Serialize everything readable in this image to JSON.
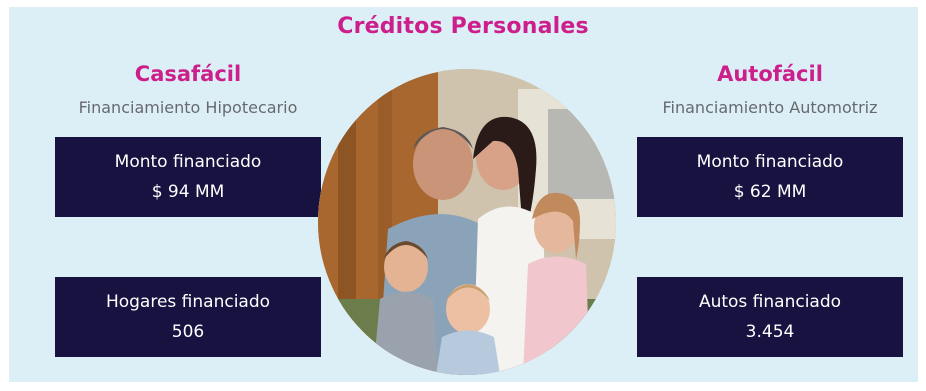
{
  "title": "Créditos Personales",
  "left": {
    "brand": "Casafácil",
    "subtitle": "Financiamiento Hipotecario",
    "cards": [
      {
        "label": "Monto financiado",
        "value": "$ 94 MM"
      },
      {
        "label": "Hogares financiado",
        "value": "506"
      }
    ]
  },
  "right": {
    "brand": "Autofácil",
    "subtitle": "Financiamiento Automotriz",
    "cards": [
      {
        "label": "Monto financiado",
        "value": "$ 62 MM"
      },
      {
        "label": "Autos financiado",
        "value": "3.454"
      }
    ]
  },
  "colors": {
    "background": "#ddeff6",
    "accent": "#cc1f8c",
    "card": "#181240",
    "subtitle": "#666a6e"
  },
  "image": "family-photo"
}
